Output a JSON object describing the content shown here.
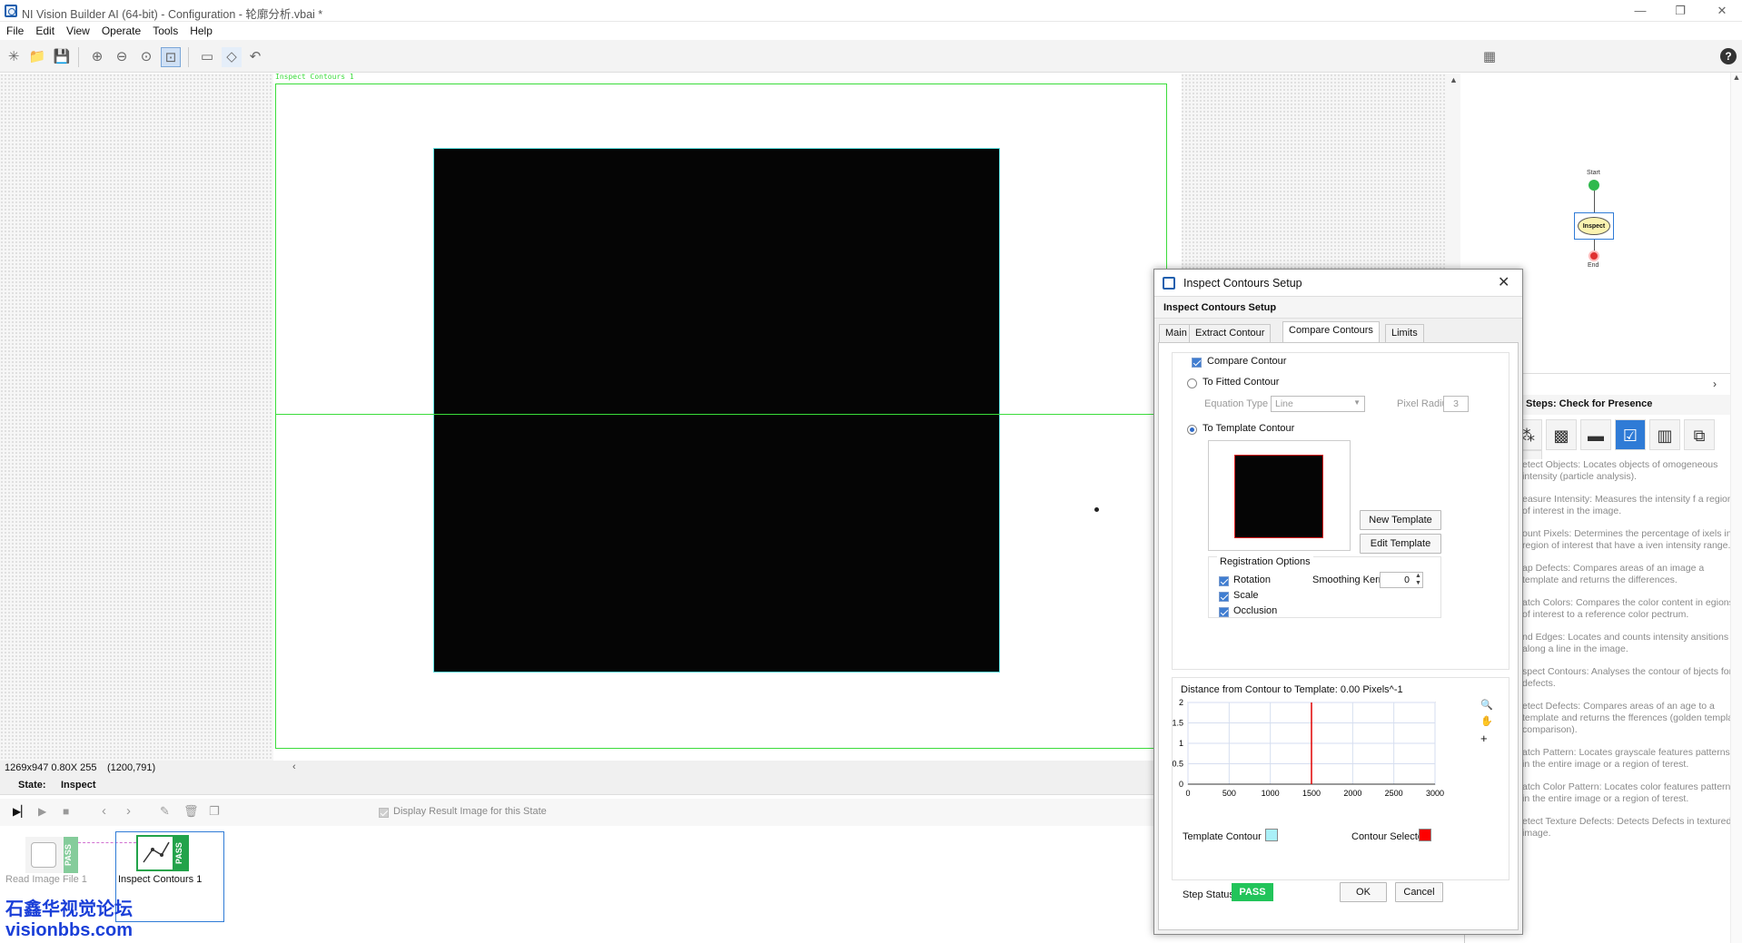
{
  "window": {
    "title": "NI Vision Builder AI (64-bit) - Configuration - 轮廓分析.vbai *",
    "min": "—",
    "max": "❐",
    "close": "✕"
  },
  "menu": [
    "File",
    "Edit",
    "View",
    "Operate",
    "Tools",
    "Help"
  ],
  "toolbar": {
    "help": "?"
  },
  "image": {
    "roi_label": "Inspect Contours 1"
  },
  "status": {
    "info": "1269x947 0.80X 255",
    "coords": "(1200,791)"
  },
  "state": {
    "label": "State:",
    "value": "Inspect",
    "display_result": "Display Result Image for this State"
  },
  "steps": [
    {
      "name": "Read Image File 1",
      "status": "PASS"
    },
    {
      "name": "Inspect Contours 1",
      "status": "PASS"
    }
  ],
  "watermark": {
    "line1": "石鑫华视觉论坛",
    "line2": "visionbbs.com"
  },
  "flow": {
    "start": "Start",
    "inspect": "Inspect",
    "end": "End"
  },
  "palette": {
    "title": "Steps: Check for Presence",
    "items": [
      "etect Objects: Locates objects of omogeneous intensity (particle analysis).",
      "easure Intensity: Measures the intensity f a region of interest in the image.",
      "ount Pixels: Determines the percentage of ixels in a region of interest that have a iven intensity range.",
      "ap Defects: Compares areas of an image a template and returns the differences.",
      "atch Colors: Compares the color content in egions of interest to a reference color pectrum.",
      "nd Edges: Locates and counts intensity ansitions along a line in the image.",
      "spect Contours: Analyses the contour of bjects for defects.",
      "etect Defects: Compares areas of an age to a template and returns the fferences (golden template comparison).",
      "atch Pattern: Locates grayscale features patterns) in the entire image or a region of terest.",
      "atch Color Pattern: Locates color features patterns) in the entire image or a region of terest.",
      "etect Texture Defects: Detects Defects in textured image."
    ]
  },
  "dialog": {
    "title": "Inspect Contours Setup",
    "subtitle": "Inspect Contours Setup",
    "tabs": [
      "Main",
      "Extract Contour",
      "Compare Contours",
      "Limits"
    ],
    "compare_contour": "Compare Contour",
    "to_fitted": "To Fitted Contour",
    "equation_type_label": "Equation Type",
    "equation_type_value": "Line",
    "pixel_radius_label": "Pixel Radius",
    "pixel_radius_value": "3",
    "to_template": "To Template Contour",
    "new_template": "New Template",
    "edit_template": "Edit Template",
    "reg_options": "Registration Options",
    "rotation": "Rotation",
    "scale": "Scale",
    "occlusion": "Occlusion",
    "smoothing_label": "Smoothing Kernel",
    "smoothing_value": "0",
    "template_contour": "Template Contour",
    "contour_selected": "Contour Selected",
    "step_status_label": "Step Status",
    "step_status": "PASS",
    "ok": "OK",
    "cancel": "Cancel"
  },
  "chart_data": {
    "type": "line",
    "title": "Distance from Contour to Template: 0.00 Pixels^-1",
    "x_ticks": [
      0,
      500,
      1000,
      1500,
      2000,
      2500,
      3000
    ],
    "y_ticks": [
      0,
      0.5,
      1,
      1.5,
      2
    ],
    "xlim": [
      0,
      3000
    ],
    "ylim": [
      0,
      2
    ],
    "series": [
      {
        "x": [
          0,
          3000
        ],
        "y": [
          0,
          0
        ]
      }
    ],
    "cursor_x": 1500,
    "grid": true,
    "colors": {
      "template": "#aaf0f8",
      "selected": "#ff0000",
      "cursor": "#e00000"
    }
  }
}
